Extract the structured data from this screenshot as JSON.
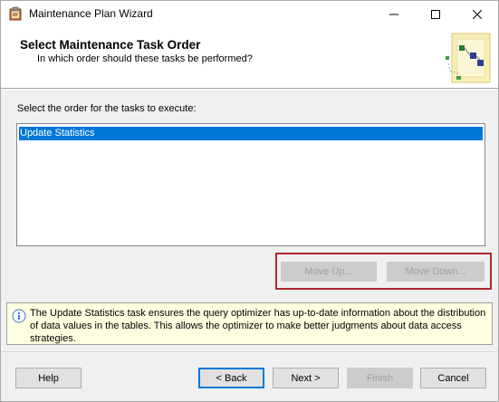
{
  "window": {
    "title": "Maintenance Plan Wizard"
  },
  "header": {
    "title": "Select Maintenance Task Order",
    "subtitle": "In which order should these tasks be performed?"
  },
  "task_list": {
    "label": "Select the order for the tasks to execute:",
    "items": [
      "Update Statistics"
    ],
    "selected_index": 0
  },
  "order_buttons": {
    "move_up": "Move Up...",
    "move_down": "Move Down..."
  },
  "info": {
    "text": "The Update Statistics task ensures the query optimizer has up-to-date information about the distribution of data values in the tables. This allows the optimizer to make better judgments about data access strategies."
  },
  "footer": {
    "help": "Help",
    "back": "< Back",
    "next": "Next >",
    "finish": "Finish",
    "cancel": "Cancel"
  },
  "colors": {
    "selection": "#0078d7",
    "highlight_border": "#b0282c",
    "info_background": "#ffffe1"
  },
  "icons": [
    "wizard-app-icon",
    "minimize-icon",
    "maximize-icon",
    "close-icon",
    "wizard-banner-icon",
    "info-icon"
  ]
}
